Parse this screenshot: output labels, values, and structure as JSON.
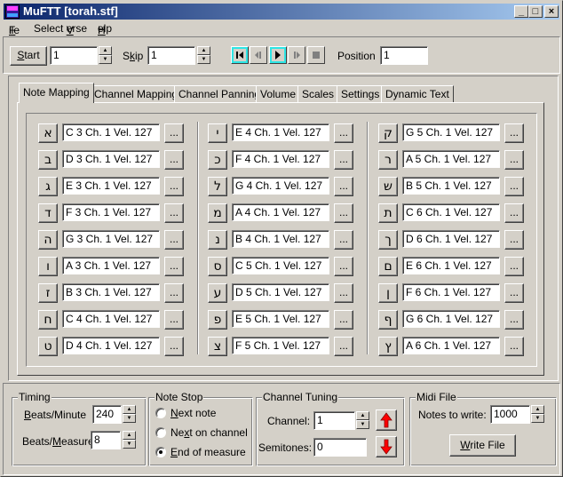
{
  "window": {
    "title": "MuFTT [torah.stf]",
    "app_icon": "mufft-app-icon",
    "controls": {
      "minimize": "_",
      "maximize": "□",
      "close": "×"
    }
  },
  "menu": {
    "items": [
      {
        "label": "File",
        "mnemonic": "F"
      },
      {
        "label": "Select Verse",
        "mnemonic": "V"
      },
      {
        "label": "Help",
        "mnemonic": "H"
      }
    ]
  },
  "toolbar": {
    "start_label": "Start",
    "start_value": "1",
    "skip_label": "Skip",
    "skip_value": "1",
    "position_label": "Position",
    "position_value": "1",
    "transport": [
      {
        "name": "rewind-to-start",
        "icon": "skip-start-icon",
        "enabled": true,
        "highlighted": true
      },
      {
        "name": "step-back",
        "icon": "step-back-icon",
        "enabled": false,
        "highlighted": false
      },
      {
        "name": "play",
        "icon": "play-icon",
        "enabled": true,
        "highlighted": true
      },
      {
        "name": "step-forward",
        "icon": "step-forward-icon",
        "enabled": false,
        "highlighted": false
      },
      {
        "name": "stop",
        "icon": "stop-icon",
        "enabled": false,
        "highlighted": false
      }
    ]
  },
  "tabs": [
    {
      "label": "Note Mapping",
      "active": true
    },
    {
      "label": "Channel Mapping",
      "active": false
    },
    {
      "label": "Channel Panning",
      "active": false
    },
    {
      "label": "Volume",
      "active": false
    },
    {
      "label": "Scales",
      "active": false
    },
    {
      "label": "Settings",
      "active": false
    },
    {
      "label": "Dynamic Text",
      "active": false
    }
  ],
  "note_mapping": {
    "dots_label": "...",
    "columns": [
      [
        {
          "letter": "א",
          "value": "C 3 Ch. 1 Vel. 127"
        },
        {
          "letter": "ב",
          "value": "D 3 Ch. 1 Vel. 127"
        },
        {
          "letter": "ג",
          "value": "E 3 Ch. 1 Vel. 127"
        },
        {
          "letter": "ד",
          "value": "F 3 Ch. 1 Vel. 127"
        },
        {
          "letter": "ה",
          "value": "G 3 Ch. 1 Vel. 127"
        },
        {
          "letter": "ו",
          "value": "A 3 Ch. 1 Vel. 127"
        },
        {
          "letter": "ז",
          "value": "B 3 Ch. 1 Vel. 127"
        },
        {
          "letter": "ח",
          "value": "C 4 Ch. 1 Vel. 127"
        },
        {
          "letter": "ט",
          "value": "D 4 Ch. 1 Vel. 127"
        }
      ],
      [
        {
          "letter": "י",
          "value": "E 4 Ch. 1 Vel. 127"
        },
        {
          "letter": "כ",
          "value": "F 4 Ch. 1 Vel. 127"
        },
        {
          "letter": "ל",
          "value": "G 4 Ch. 1 Vel. 127"
        },
        {
          "letter": "מ",
          "value": "A 4 Ch. 1 Vel. 127"
        },
        {
          "letter": "נ",
          "value": "B 4 Ch. 1 Vel. 127"
        },
        {
          "letter": "ס",
          "value": "C 5 Ch. 1 Vel. 127"
        },
        {
          "letter": "ע",
          "value": "D 5 Ch. 1 Vel. 127"
        },
        {
          "letter": "פ",
          "value": "E 5 Ch. 1 Vel. 127"
        },
        {
          "letter": "צ",
          "value": "F 5 Ch. 1 Vel. 127"
        }
      ],
      [
        {
          "letter": "ק",
          "value": "G 5 Ch. 1 Vel. 127"
        },
        {
          "letter": "ר",
          "value": "A 5 Ch. 1 Vel. 127"
        },
        {
          "letter": "ש",
          "value": "B 5 Ch. 1 Vel. 127"
        },
        {
          "letter": "ת",
          "value": "C 6 Ch. 1 Vel. 127"
        },
        {
          "letter": "ך",
          "value": "D 6 Ch. 1 Vel. 127"
        },
        {
          "letter": "ם",
          "value": "E 6 Ch. 1 Vel. 127"
        },
        {
          "letter": "ן",
          "value": "F 6 Ch. 1 Vel. 127"
        },
        {
          "letter": "ף",
          "value": "G 6 Ch. 1 Vel. 127"
        },
        {
          "letter": "ץ",
          "value": "A 6 Ch. 1 Vel. 127"
        }
      ]
    ]
  },
  "timing": {
    "title": "Timing",
    "bpm_label": "Beats/Minute",
    "bpm_value": "240",
    "bpmeasure_label": "Beats/Measure",
    "bpmeasure_value": "8"
  },
  "note_stop": {
    "title": "Note Stop",
    "options": [
      {
        "label": "Next note",
        "checked": false
      },
      {
        "label": "Next on channel",
        "checked": false
      },
      {
        "label": "End of measure",
        "checked": true
      }
    ]
  },
  "channel_tuning": {
    "title": "Channel Tuning",
    "channel_label": "Channel:",
    "channel_value": "1",
    "semitones_label": "Semitones:",
    "semitones_value": "0",
    "arrow_color": "#ff0000"
  },
  "midi_file": {
    "title": "Midi File",
    "notes_label": "Notes to write:",
    "notes_value": "1000",
    "write_label": "Write File"
  }
}
